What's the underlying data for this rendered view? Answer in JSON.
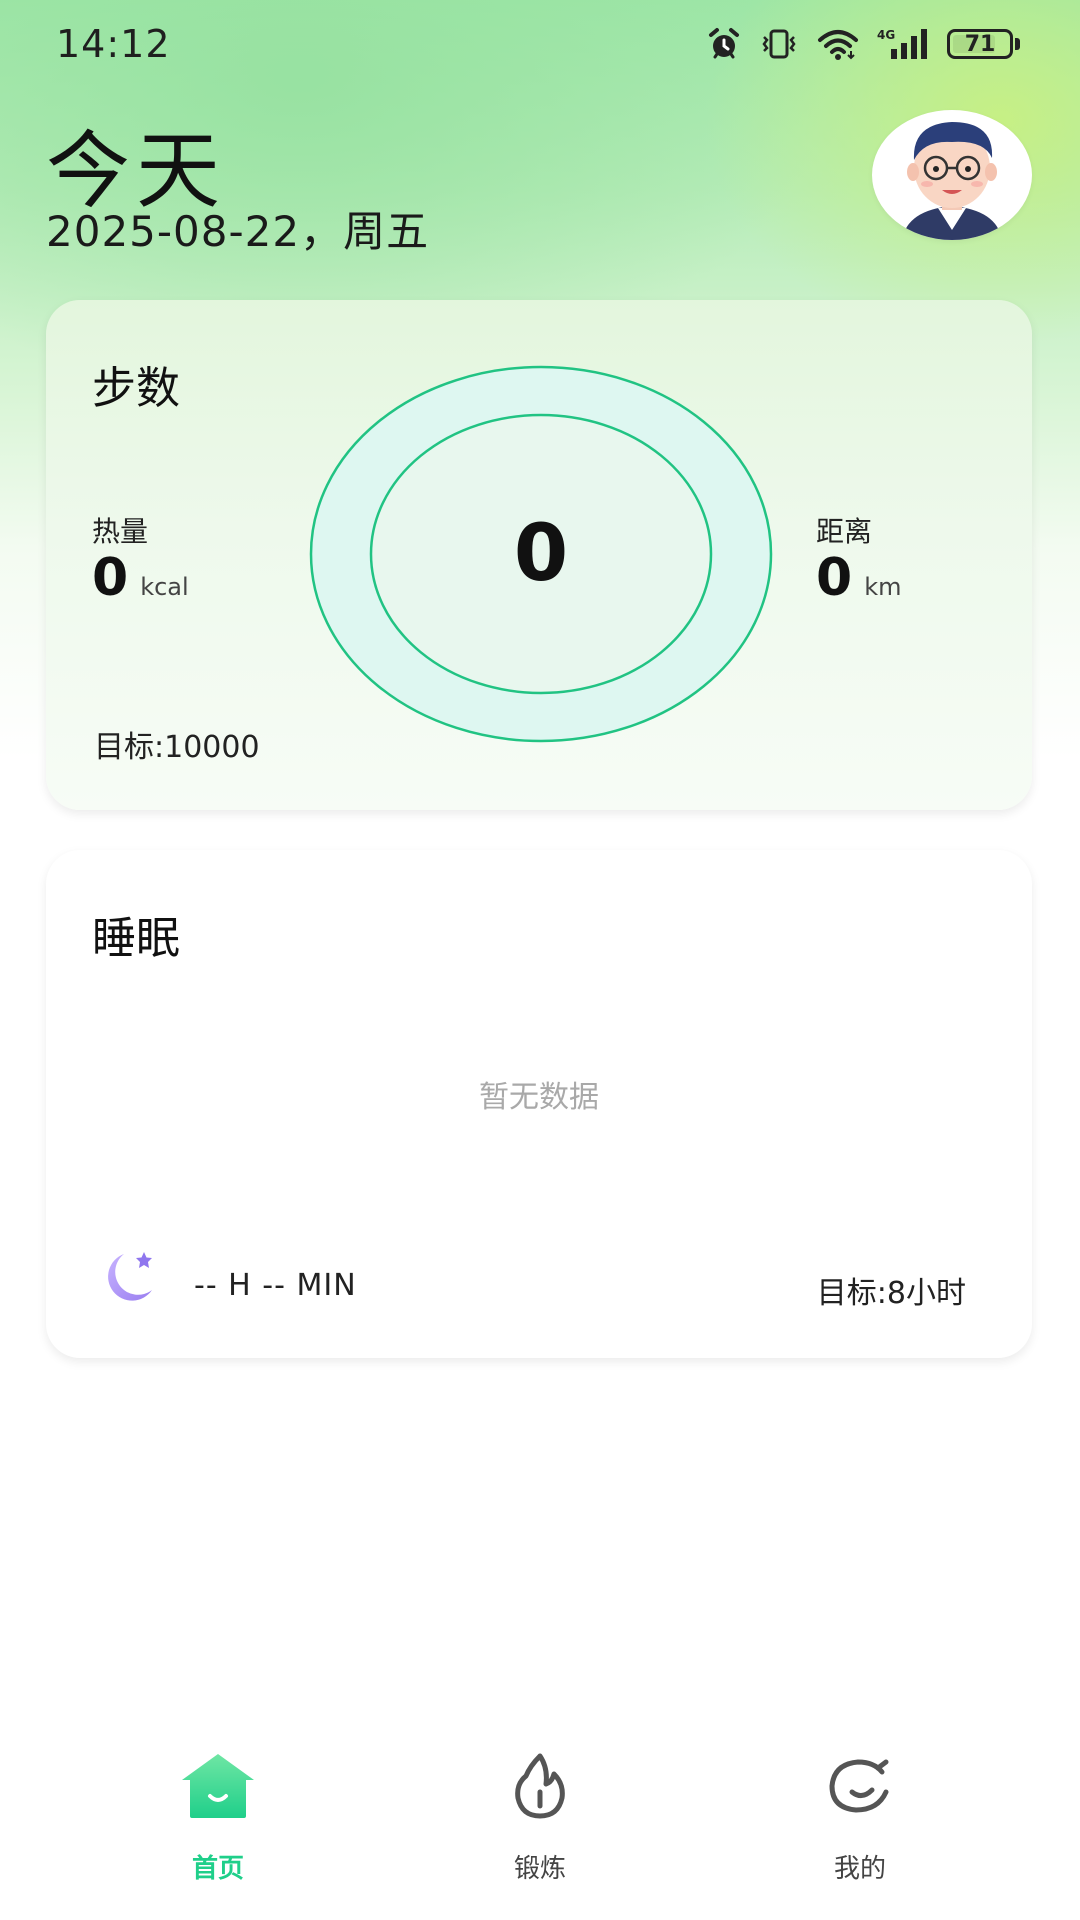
{
  "status_bar": {
    "time": "14:12",
    "network": "4G",
    "battery": "71",
    "icons": [
      "alarm-icon",
      "vibrate-icon",
      "wifi-icon",
      "signal-icon",
      "battery-icon"
    ]
  },
  "header": {
    "title": "今天",
    "date": "2025-08-22，周五",
    "avatar": "avatar"
  },
  "steps_card": {
    "title": "步数",
    "steps": "0",
    "calories_label": "热量",
    "calories_value": "0",
    "calories_unit": "kcal",
    "distance_label": "距离",
    "distance_value": "0",
    "distance_unit": "km",
    "goal": "目标:10000"
  },
  "sleep_card": {
    "title": "睡眠",
    "empty": "暂无数据",
    "duration": "-- H -- MIN",
    "goal": "目标:8小时"
  },
  "bottom_nav": [
    {
      "label": "首页",
      "icon": "home-icon",
      "active": true
    },
    {
      "label": "锻炼",
      "icon": "workout-icon",
      "active": false
    },
    {
      "label": "我的",
      "icon": "profile-icon",
      "active": false
    }
  ],
  "colors": {
    "accent": "#1fcf8a",
    "ring": "#21c383",
    "moon": "#a58af0"
  }
}
